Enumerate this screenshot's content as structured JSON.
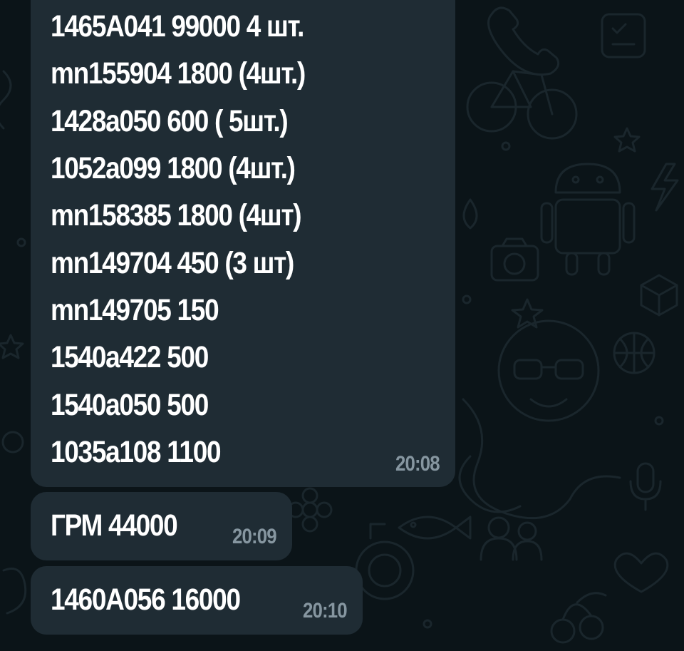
{
  "messages": [
    {
      "lines": [
        "1465A041 99000 4 шт.",
        "mn155904 1800 (4шт.)",
        "1428a050 600 ( 5шт.)",
        "1052a099 1800 (4шт.)",
        "mn158385 1800 (4шт)",
        "mn149704 450 (3 шт)",
        "mn149705 150",
        "1540a422 500",
        "1540a050 500",
        "1035a108 1100"
      ],
      "time": "20:08"
    },
    {
      "lines": [
        "ГРМ 44000"
      ],
      "time": "20:09"
    },
    {
      "lines": [
        "1460A056 16000"
      ],
      "time": "20:10"
    }
  ],
  "colors": {
    "background": "#0b1418",
    "bubble": "#1f2c34",
    "text": "#ffffff",
    "timestamp": "#8696a0",
    "doodle": "#1a262c"
  }
}
